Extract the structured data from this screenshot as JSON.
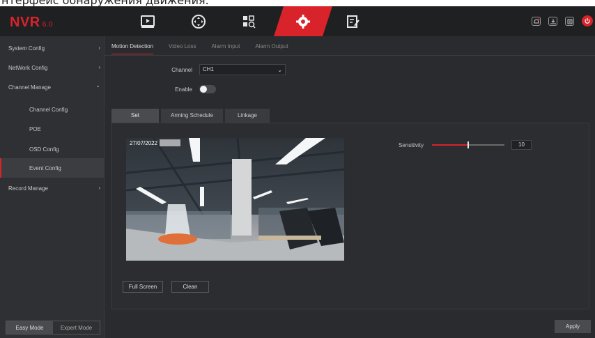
{
  "caption": "нтерфейс обнаружения движения.",
  "logo": {
    "brand": "NVR",
    "version": "6.0"
  },
  "nav_icons": [
    "playback-icon",
    "ptz-icon",
    "search-icon",
    "settings-icon",
    "maintenance-icon"
  ],
  "top_right_icons": [
    "alarm-icon",
    "download-icon",
    "file-icon",
    "power-icon"
  ],
  "sidebar": {
    "items": [
      {
        "label": "System Config",
        "chevron": "›"
      },
      {
        "label": "NetWork Config",
        "chevron": "›"
      },
      {
        "label": "Channel Manage",
        "chevron": "⌄"
      },
      {
        "label": "Channel Config"
      },
      {
        "label": "POE"
      },
      {
        "label": "OSD Config"
      },
      {
        "label": "Event Config"
      },
      {
        "label": "Record Manage",
        "chevron": "›"
      }
    ],
    "modes": [
      "Easy Mode",
      "Expert Mode"
    ]
  },
  "main": {
    "tabs": [
      "Motion Detection",
      "Video Loss",
      "Alarm Input",
      "Alarm Output"
    ],
    "channel_label": "Channel",
    "channel_value": "CH1",
    "enable_label": "Enable",
    "subtabs": [
      "Set",
      "Arming Schedule",
      "Linkage"
    ],
    "timestamp": "27/07/2022",
    "sensitivity_label": "Sensitivity",
    "sensitivity_value": "10",
    "sensitivity_fraction": 0.5,
    "buttons": {
      "full_screen": "Full Screen",
      "clean": "Clean",
      "apply": "Apply"
    }
  },
  "colors": {
    "accent": "#d8232a",
    "background": "#2a2b2e",
    "topbar": "#1f2022"
  }
}
